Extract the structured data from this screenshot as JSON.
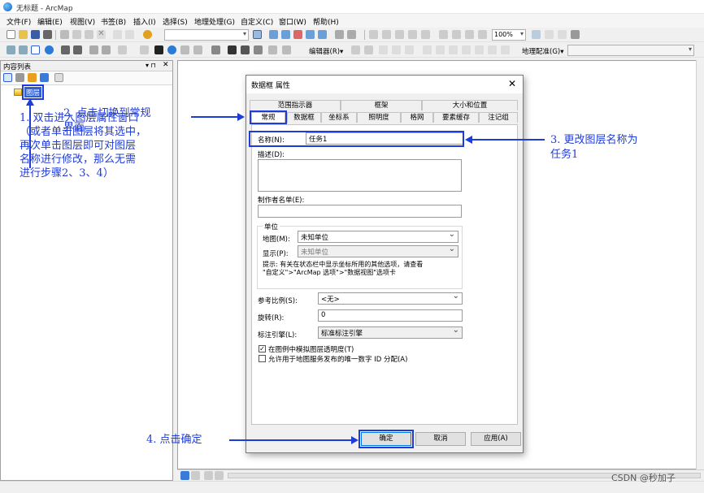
{
  "window": {
    "title": "无标题 - ArcMap"
  },
  "menu": [
    "文件(F)",
    "编辑(E)",
    "视图(V)",
    "书签(B)",
    "插入(I)",
    "选择(S)",
    "地理处理(G)",
    "自定义(C)",
    "窗口(W)",
    "帮助(H)"
  ],
  "toolbar": {
    "zoom": "100%",
    "editor": "编辑器(R)▾",
    "georef": "地理配准(G)▾"
  },
  "toc": {
    "title": "内容列表",
    "pin": "▾ ⊓",
    "close": "✕",
    "layer": "图层"
  },
  "dialog": {
    "title": "数据框 属性",
    "close": "✕",
    "tabs_row1": [
      "范围指示器",
      "框架",
      "大小和位置"
    ],
    "tabs_row2": [
      "常规",
      "数据框",
      "坐标系",
      "照明度",
      "格网",
      "要素缓存",
      "注记组"
    ],
    "name_label": "名称(N):",
    "name_value": "任务1",
    "desc_label": "描述(D):",
    "credits_label": "制作者名单(E):",
    "units_group": "单位",
    "map_units_label": "地图(M):",
    "map_units_value": "未知单位",
    "display_units_label": "显示(P):",
    "display_units_value": "未知单位",
    "tip": "提示: 有关在状态栏中显示坐标所用的其他选项，请查看\n\"自定义\">\"ArcMap 选项\">\"数据视图\"选项卡",
    "ref_scale_label": "参考比例(S):",
    "ref_scale_value": "<无>",
    "rotation_label": "旋转(R):",
    "rotation_value": "0",
    "label_engine_label": "标注引擎(L):",
    "label_engine_value": "标准标注引擎",
    "check1": "在图例中模拟图层透明度(T)",
    "check1_state": "✓",
    "check2": "允许用于地图服务发布的唯一数字 ID 分配(A)",
    "ok": "确定",
    "cancel": "取消",
    "apply": "应用(A)"
  },
  "annotations": {
    "a1": "1. 双击进入图层属性窗口\n（或者单击图层将其选中，\n再次单击图层即可对图层\n名称进行修改，那么无需\n进行步骤2、3、4）",
    "a2": "2. 点击切换到常规\n界面",
    "a3": "3. 更改图层名称为\n任务1",
    "a4": "4. 点击确定"
  },
  "watermark": "CSDN @秒加子",
  "colors": {
    "annotation": "#1f3bd8",
    "selection": "#3060d0"
  }
}
